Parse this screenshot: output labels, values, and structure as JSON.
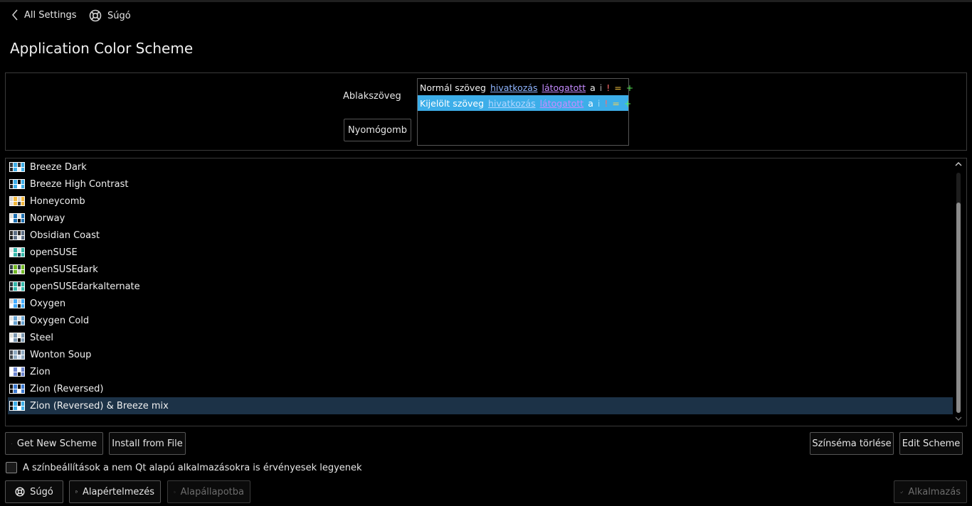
{
  "topbar": {
    "back_label": "All Settings",
    "help_label": "Súgó"
  },
  "page": {
    "title": "Application Color Scheme"
  },
  "preview": {
    "window_text_label": "Ablakszöveg",
    "push_button_label": "Nyomógomb",
    "normal_row": {
      "text": "Normál szöveg",
      "link": "hivatkozás",
      "visited": "látogatott",
      "a": "a",
      "i": "i",
      "excl": "!",
      "eq": "=",
      "plus": "+"
    },
    "selected_row": {
      "text": "Kijelölt szöveg",
      "link": "hivatkozás",
      "visited": "látogatott",
      "a": "a",
      "i": "i",
      "excl": "!",
      "eq": "=",
      "plus": "+"
    }
  },
  "schemes": {
    "selected_index": 14,
    "items": [
      {
        "label": "Breeze Dark",
        "colors": [
          "#31363b",
          "#3daee9",
          "#232629",
          "#eff0f1"
        ]
      },
      {
        "label": "Breeze High Contrast",
        "colors": [
          "#0a0a0a",
          "#3daee9",
          "#1c1c1c",
          "#ffffff"
        ]
      },
      {
        "label": "Honeycomb",
        "colors": [
          "#d6d2d0",
          "#f3b83c",
          "#e3dfdd",
          "#3c3c3c"
        ]
      },
      {
        "label": "Norway",
        "colors": [
          "#e0dfd8",
          "#1e71b2",
          "#ffffff",
          "#000000"
        ]
      },
      {
        "label": "Obsidian Coast",
        "colors": [
          "#302f2d",
          "#5c6e84",
          "#1a1a1a",
          "#e1e1e1"
        ]
      },
      {
        "label": "openSUSE",
        "colors": [
          "#e6e6e6",
          "#35b9ab",
          "#ffffff",
          "#173f4f"
        ]
      },
      {
        "label": "openSUSEdark",
        "colors": [
          "#2f3b40",
          "#73ba25",
          "#1d2a2f",
          "#d2d2d2"
        ]
      },
      {
        "label": "openSUSEdarkalternate",
        "colors": [
          "#283237",
          "#35b9ab",
          "#1b2327",
          "#d9d9d9"
        ]
      },
      {
        "label": "Oxygen",
        "colors": [
          "#d6d2d0",
          "#43acff",
          "#ffffff",
          "#1f1c1b"
        ]
      },
      {
        "label": "Oxygen Cold",
        "colors": [
          "#e0dfde",
          "#68a4d3",
          "#ffffff",
          "#232627"
        ]
      },
      {
        "label": "Steel",
        "colors": [
          "#e0dfd8",
          "#7c98b1",
          "#ffffff",
          "#000000"
        ]
      },
      {
        "label": "Wonton Soup",
        "colors": [
          "#494e58",
          "#8faac2",
          "#3b4045",
          "#d2deef"
        ]
      },
      {
        "label": "Zion",
        "colors": [
          "#ffffff",
          "#6e87d2",
          "#ffffff",
          "#000000"
        ]
      },
      {
        "label": "Zion (Reversed)",
        "colors": [
          "#000000",
          "#3c7ad1",
          "#000000",
          "#ffffff"
        ]
      },
      {
        "label": "Zion (Reversed) & Breeze mix",
        "colors": [
          "#000000",
          "#3daee9",
          "#000000",
          "#ffffff"
        ]
      }
    ]
  },
  "actions": {
    "get_new": "Get New Scheme",
    "install_file": "Install from File",
    "remove": "Színséma törlése",
    "edit": "Edit Scheme"
  },
  "options": {
    "apply_non_qt_label": "A színbeállítások a nem Qt alapú alkalmazásokra is érvényesek legyenek",
    "apply_non_qt_checked": false
  },
  "footer": {
    "help": "Súgó",
    "defaults": "Alapértelmezés",
    "reset": "Alapállapotba",
    "apply": "Alkalmazás"
  },
  "colors": {
    "selection": "#3daee9",
    "list_selection": "#1c3247",
    "link": "#2980b9",
    "visited": "#9b59b6"
  }
}
